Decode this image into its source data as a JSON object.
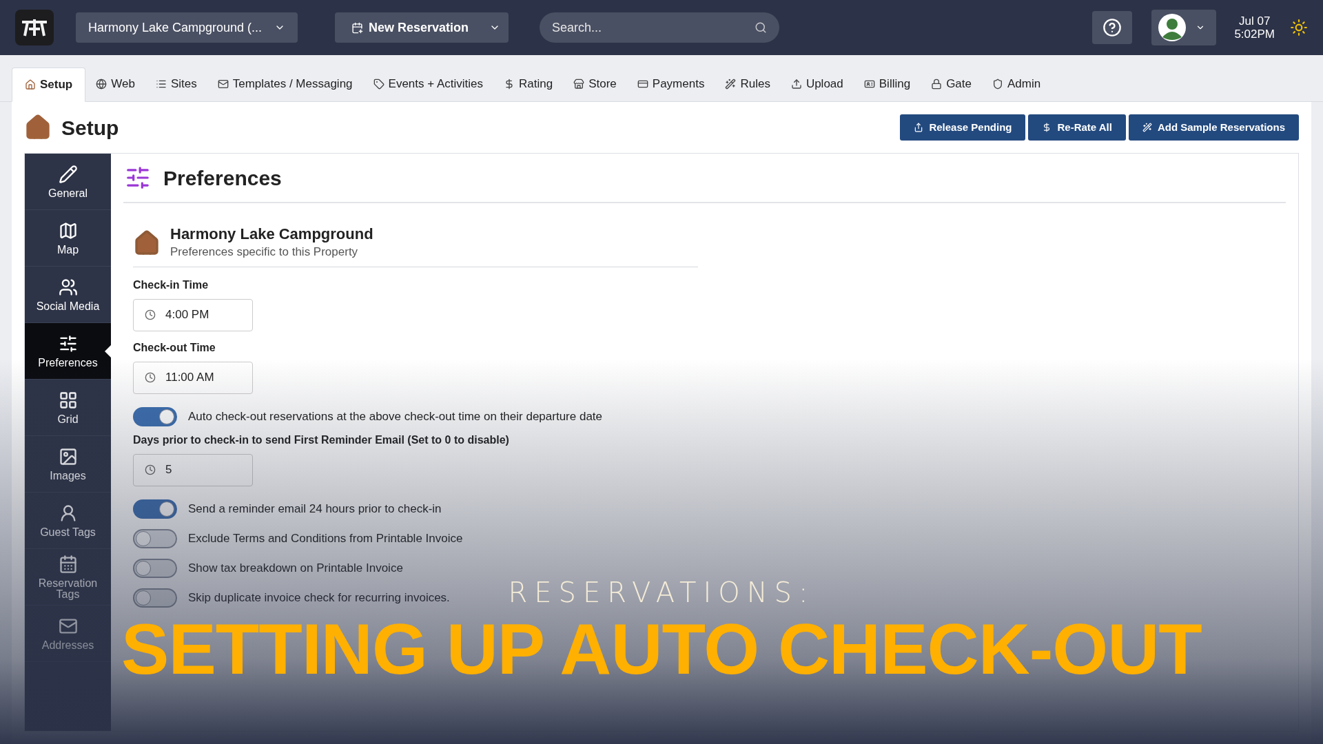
{
  "topbar": {
    "property": "Harmony Lake Campground (...",
    "new_reservation": "New Reservation",
    "search": {
      "placeholder": "Search..."
    },
    "date": "Jul 07",
    "time": "5:02PM"
  },
  "tabs": [
    {
      "label": "Setup",
      "selected": true
    },
    {
      "label": "Web",
      "selected": false
    },
    {
      "label": "Sites",
      "selected": false
    },
    {
      "label": "Templates / Messaging",
      "selected": false
    },
    {
      "label": "Events + Activities",
      "selected": false
    },
    {
      "label": "Rating",
      "selected": false
    },
    {
      "label": "Store",
      "selected": false
    },
    {
      "label": "Payments",
      "selected": false
    },
    {
      "label": "Rules",
      "selected": false
    },
    {
      "label": "Upload",
      "selected": false
    },
    {
      "label": "Billing",
      "selected": false
    },
    {
      "label": "Gate",
      "selected": false
    },
    {
      "label": "Admin",
      "selected": false
    }
  ],
  "page": {
    "title": "Setup",
    "actions": [
      "Release Pending",
      "Re-Rate All",
      "Add Sample Reservations"
    ]
  },
  "sidebar": {
    "items": [
      {
        "label": "General",
        "selected": false
      },
      {
        "label": "Map",
        "selected": false
      },
      {
        "label": "Social Media",
        "selected": false
      },
      {
        "label": "Preferences",
        "selected": true
      },
      {
        "label": "Grid",
        "selected": false
      },
      {
        "label": "Images",
        "selected": false
      },
      {
        "label": "Guest Tags",
        "selected": false
      },
      {
        "label": "Reservation Tags",
        "selected": false
      },
      {
        "label": "Addresses",
        "selected": false
      }
    ]
  },
  "panel": {
    "title": "Preferences",
    "property_name": "Harmony Lake Campground",
    "property_subtitle": "Preferences specific to this Property",
    "settings": [
      {
        "kind": "time",
        "label": "Check-in Time",
        "value": "4:00 PM"
      },
      {
        "kind": "time",
        "label": "Check-out Time",
        "value": "11:00 AM"
      },
      {
        "kind": "toggle",
        "label": "Auto check-out reservations at the above check-out time on their departure date",
        "on": true
      },
      {
        "kind": "time",
        "label": "Days prior to check-in to send First Reminder Email (Set to 0 to disable)",
        "value": "5"
      },
      {
        "kind": "toggle",
        "label": "Send a reminder email 24 hours prior to check-in",
        "on": true
      },
      {
        "kind": "toggle",
        "label": "Exclude Terms and Conditions from Printable Invoice",
        "on": false
      },
      {
        "kind": "toggle",
        "label": "Show tax breakdown on Printable Invoice",
        "on": false
      },
      {
        "kind": "toggle",
        "label": "Skip duplicate invoice check for recurring invoices.",
        "on": false
      }
    ]
  },
  "overlay": {
    "kicker": "RESERVATIONS:",
    "headline": "SETTING UP AUTO CHECK-OUT"
  }
}
